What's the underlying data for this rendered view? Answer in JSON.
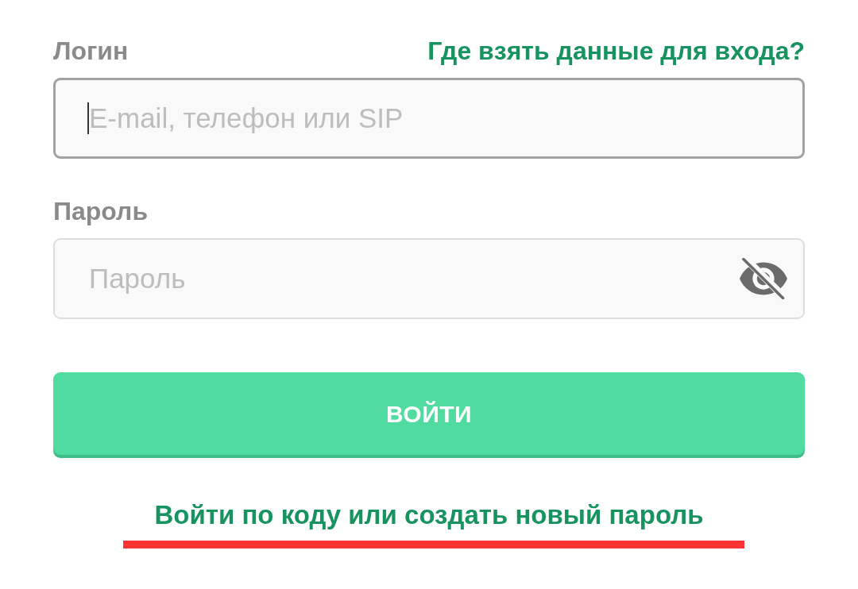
{
  "login": {
    "label": "Логин",
    "help_link": "Где взять данные для входа?",
    "placeholder": "E-mail, телефон или SIP",
    "focused": true
  },
  "password": {
    "label": "Пароль",
    "placeholder": "Пароль",
    "focused": false,
    "password_shown": false
  },
  "submit_button": "ВОЙТИ",
  "code_login_link": {
    "text": "Войти по коду или создать новый пароль",
    "marked": true
  }
}
